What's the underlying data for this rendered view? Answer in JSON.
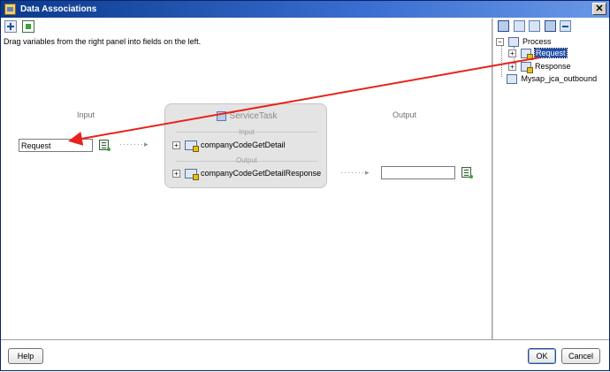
{
  "window": {
    "title": "Data Associations",
    "close_label": "✕"
  },
  "instruction": "Drag variables from the right panel into fields on the left.",
  "mapping": {
    "input_label": "Input",
    "output_label": "Output",
    "input_field_value": "Request",
    "output_field_value": ""
  },
  "service_task": {
    "title": "ServiceTask",
    "input_label": "Input",
    "output_label": "Output",
    "input_item": "companyCodeGetDetail",
    "output_item": "companyCodeGetDetailResponse"
  },
  "tree": {
    "root": "Process",
    "children": [
      "Request",
      "Response"
    ],
    "sibling": "Mysap_jca_outbound"
  },
  "buttons": {
    "help": "Help",
    "ok": "OK",
    "cancel": "Cancel"
  },
  "colors": {
    "arrow": "#e8221c",
    "selection": "#2050b0",
    "titlebar": "#0a3a8c"
  }
}
